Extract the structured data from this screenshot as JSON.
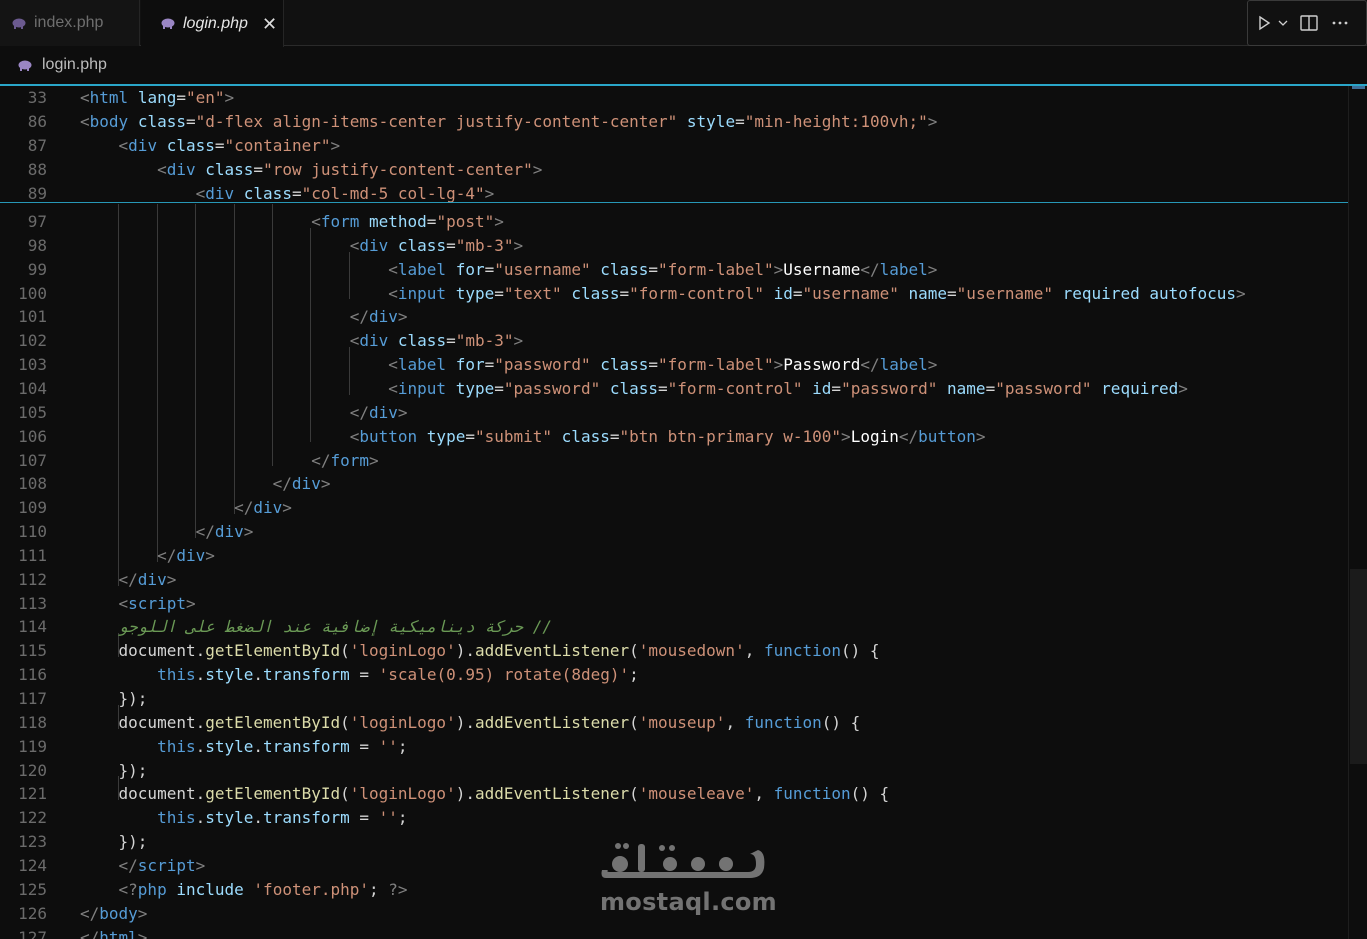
{
  "tabs": [
    {
      "label": "index.php",
      "active": false
    },
    {
      "label": "login.php",
      "active": true
    }
  ],
  "tab_close_glyph": "✕",
  "actions": {
    "run_icon": "play-icon",
    "dropdown_icon": "chevron-down-icon",
    "split_icon": "split-editor-icon",
    "more_icon": "more-icon"
  },
  "breadcrumb": {
    "file": "login.php"
  },
  "colors": {
    "accent": "#2aa6c9",
    "tag": "#569cd6",
    "attribute": "#9cdcfe",
    "string": "#ce9178",
    "function": "#dcdcaa",
    "comment": "#6a9955"
  },
  "sticky_lines": [
    {
      "num": "33",
      "tokens": [
        [
          "p",
          "<"
        ],
        [
          "t",
          "html"
        ],
        [
          "x",
          " "
        ],
        [
          "a",
          "lang"
        ],
        [
          "x",
          "="
        ],
        [
          "s",
          "\"en\""
        ],
        [
          "p",
          ">"
        ]
      ]
    },
    {
      "num": "86",
      "tokens": [
        [
          "p",
          "<"
        ],
        [
          "t",
          "body"
        ],
        [
          "x",
          " "
        ],
        [
          "a",
          "class"
        ],
        [
          "x",
          "="
        ],
        [
          "s",
          "\"d-flex align-items-center justify-content-center\""
        ],
        [
          "x",
          " "
        ],
        [
          "a",
          "style"
        ],
        [
          "x",
          "="
        ],
        [
          "s",
          "\"min-height:100vh;\""
        ],
        [
          "p",
          ">"
        ]
      ]
    },
    {
      "num": "87",
      "tokens": [
        [
          "x",
          "    "
        ],
        [
          "p",
          "<"
        ],
        [
          "t",
          "div"
        ],
        [
          "x",
          " "
        ],
        [
          "a",
          "class"
        ],
        [
          "x",
          "="
        ],
        [
          "s",
          "\"container\""
        ],
        [
          "p",
          ">"
        ]
      ]
    },
    {
      "num": "88",
      "tokens": [
        [
          "x",
          "        "
        ],
        [
          "p",
          "<"
        ],
        [
          "t",
          "div"
        ],
        [
          "x",
          " "
        ],
        [
          "a",
          "class"
        ],
        [
          "x",
          "="
        ],
        [
          "s",
          "\"row justify-content-center\""
        ],
        [
          "p",
          ">"
        ]
      ]
    },
    {
      "num": "89",
      "tokens": [
        [
          "x",
          "            "
        ],
        [
          "p",
          "<"
        ],
        [
          "t",
          "div"
        ],
        [
          "x",
          " "
        ],
        [
          "a",
          "class"
        ],
        [
          "x",
          "="
        ],
        [
          "s",
          "\"col-md-5 col-lg-4\""
        ],
        [
          "p",
          ">"
        ]
      ]
    }
  ],
  "lines": [
    {
      "num": "97",
      "tokens": [
        [
          "x",
          "                        "
        ],
        [
          "p",
          "<"
        ],
        [
          "t",
          "form"
        ],
        [
          "x",
          " "
        ],
        [
          "a",
          "method"
        ],
        [
          "x",
          "="
        ],
        [
          "s",
          "\"post\""
        ],
        [
          "p",
          ">"
        ]
      ]
    },
    {
      "num": "98",
      "tokens": [
        [
          "x",
          "                            "
        ],
        [
          "p",
          "<"
        ],
        [
          "t",
          "div"
        ],
        [
          "x",
          " "
        ],
        [
          "a",
          "class"
        ],
        [
          "x",
          "="
        ],
        [
          "s",
          "\"mb-3\""
        ],
        [
          "p",
          ">"
        ]
      ]
    },
    {
      "num": "99",
      "tokens": [
        [
          "x",
          "                                "
        ],
        [
          "p",
          "<"
        ],
        [
          "t",
          "label"
        ],
        [
          "x",
          " "
        ],
        [
          "a",
          "for"
        ],
        [
          "x",
          "="
        ],
        [
          "s",
          "\"username\""
        ],
        [
          "x",
          " "
        ],
        [
          "a",
          "class"
        ],
        [
          "x",
          "="
        ],
        [
          "s",
          "\"form-label\""
        ],
        [
          "p",
          ">"
        ],
        [
          "tx",
          "Username"
        ],
        [
          "p",
          "</"
        ],
        [
          "t",
          "label"
        ],
        [
          "p",
          ">"
        ]
      ]
    },
    {
      "num": "100",
      "tokens": [
        [
          "x",
          "                                "
        ],
        [
          "p",
          "<"
        ],
        [
          "t",
          "input"
        ],
        [
          "x",
          " "
        ],
        [
          "a",
          "type"
        ],
        [
          "x",
          "="
        ],
        [
          "s",
          "\"text\""
        ],
        [
          "x",
          " "
        ],
        [
          "a",
          "class"
        ],
        [
          "x",
          "="
        ],
        [
          "s",
          "\"form-control\""
        ],
        [
          "x",
          " "
        ],
        [
          "a",
          "id"
        ],
        [
          "x",
          "="
        ],
        [
          "s",
          "\"username\""
        ],
        [
          "x",
          " "
        ],
        [
          "a",
          "name"
        ],
        [
          "x",
          "="
        ],
        [
          "s",
          "\"username\""
        ],
        [
          "x",
          " "
        ],
        [
          "a",
          "required"
        ],
        [
          "x",
          " "
        ],
        [
          "a",
          "autofocus"
        ],
        [
          "p",
          ">"
        ]
      ]
    },
    {
      "num": "101",
      "tokens": [
        [
          "x",
          "                            "
        ],
        [
          "p",
          "</"
        ],
        [
          "t",
          "div"
        ],
        [
          "p",
          ">"
        ]
      ]
    },
    {
      "num": "102",
      "tokens": [
        [
          "x",
          "                            "
        ],
        [
          "p",
          "<"
        ],
        [
          "t",
          "div"
        ],
        [
          "x",
          " "
        ],
        [
          "a",
          "class"
        ],
        [
          "x",
          "="
        ],
        [
          "s",
          "\"mb-3\""
        ],
        [
          "p",
          ">"
        ]
      ]
    },
    {
      "num": "103",
      "tokens": [
        [
          "x",
          "                                "
        ],
        [
          "p",
          "<"
        ],
        [
          "t",
          "label"
        ],
        [
          "x",
          " "
        ],
        [
          "a",
          "for"
        ],
        [
          "x",
          "="
        ],
        [
          "s",
          "\"password\""
        ],
        [
          "x",
          " "
        ],
        [
          "a",
          "class"
        ],
        [
          "x",
          "="
        ],
        [
          "s",
          "\"form-label\""
        ],
        [
          "p",
          ">"
        ],
        [
          "tx",
          "Password"
        ],
        [
          "p",
          "</"
        ],
        [
          "t",
          "label"
        ],
        [
          "p",
          ">"
        ]
      ]
    },
    {
      "num": "104",
      "tokens": [
        [
          "x",
          "                                "
        ],
        [
          "p",
          "<"
        ],
        [
          "t",
          "input"
        ],
        [
          "x",
          " "
        ],
        [
          "a",
          "type"
        ],
        [
          "x",
          "="
        ],
        [
          "s",
          "\"password\""
        ],
        [
          "x",
          " "
        ],
        [
          "a",
          "class"
        ],
        [
          "x",
          "="
        ],
        [
          "s",
          "\"form-control\""
        ],
        [
          "x",
          " "
        ],
        [
          "a",
          "id"
        ],
        [
          "x",
          "="
        ],
        [
          "s",
          "\"password\""
        ],
        [
          "x",
          " "
        ],
        [
          "a",
          "name"
        ],
        [
          "x",
          "="
        ],
        [
          "s",
          "\"password\""
        ],
        [
          "x",
          " "
        ],
        [
          "a",
          "required"
        ],
        [
          "p",
          ">"
        ]
      ]
    },
    {
      "num": "105",
      "tokens": [
        [
          "x",
          "                            "
        ],
        [
          "p",
          "</"
        ],
        [
          "t",
          "div"
        ],
        [
          "p",
          ">"
        ]
      ]
    },
    {
      "num": "106",
      "tokens": [
        [
          "x",
          "                            "
        ],
        [
          "p",
          "<"
        ],
        [
          "t",
          "button"
        ],
        [
          "x",
          " "
        ],
        [
          "a",
          "type"
        ],
        [
          "x",
          "="
        ],
        [
          "s",
          "\"submit\""
        ],
        [
          "x",
          " "
        ],
        [
          "a",
          "class"
        ],
        [
          "x",
          "="
        ],
        [
          "s",
          "\"btn btn-primary w-100\""
        ],
        [
          "p",
          ">"
        ],
        [
          "tx",
          "Login"
        ],
        [
          "p",
          "</"
        ],
        [
          "t",
          "button"
        ],
        [
          "p",
          ">"
        ]
      ]
    },
    {
      "num": "107",
      "tokens": [
        [
          "x",
          "                        "
        ],
        [
          "p",
          "</"
        ],
        [
          "t",
          "form"
        ],
        [
          "p",
          ">"
        ]
      ]
    },
    {
      "num": "108",
      "tokens": [
        [
          "x",
          "                    "
        ],
        [
          "p",
          "</"
        ],
        [
          "t",
          "div"
        ],
        [
          "p",
          ">"
        ]
      ]
    },
    {
      "num": "109",
      "tokens": [
        [
          "x",
          "                "
        ],
        [
          "p",
          "</"
        ],
        [
          "t",
          "div"
        ],
        [
          "p",
          ">"
        ]
      ]
    },
    {
      "num": "110",
      "tokens": [
        [
          "x",
          "            "
        ],
        [
          "p",
          "</"
        ],
        [
          "t",
          "div"
        ],
        [
          "p",
          ">"
        ]
      ]
    },
    {
      "num": "111",
      "tokens": [
        [
          "x",
          "        "
        ],
        [
          "p",
          "</"
        ],
        [
          "t",
          "div"
        ],
        [
          "p",
          ">"
        ]
      ]
    },
    {
      "num": "112",
      "tokens": [
        [
          "x",
          "    "
        ],
        [
          "p",
          "</"
        ],
        [
          "t",
          "div"
        ],
        [
          "p",
          ">"
        ]
      ]
    },
    {
      "num": "113",
      "tokens": [
        [
          "x",
          "    "
        ],
        [
          "p",
          "<"
        ],
        [
          "t",
          "script"
        ],
        [
          "p",
          ">"
        ]
      ]
    },
    {
      "num": "114",
      "tokens": [
        [
          "x",
          "    "
        ],
        [
          "c",
          "// حركة ديناميكية إضافية عند الضغط على اللوجو"
        ]
      ]
    },
    {
      "num": "115",
      "tokens": [
        [
          "x",
          "    "
        ],
        [
          "x",
          "document."
        ],
        [
          "f",
          "getElementById"
        ],
        [
          "x",
          "("
        ],
        [
          "s",
          "'loginLogo'"
        ],
        [
          "x",
          ")."
        ],
        [
          "f",
          "addEventListener"
        ],
        [
          "x",
          "("
        ],
        [
          "s",
          "'mousedown'"
        ],
        [
          "x",
          ", "
        ],
        [
          "k",
          "function"
        ],
        [
          "x",
          "() {"
        ]
      ]
    },
    {
      "num": "116",
      "tokens": [
        [
          "x",
          "        "
        ],
        [
          "k",
          "this"
        ],
        [
          "x",
          "."
        ],
        [
          "pr",
          "style"
        ],
        [
          "x",
          "."
        ],
        [
          "pr",
          "transform"
        ],
        [
          "x",
          " = "
        ],
        [
          "s",
          "'scale(0.95) rotate(8deg)'"
        ],
        [
          "x",
          ";"
        ]
      ]
    },
    {
      "num": "117",
      "tokens": [
        [
          "x",
          "    "
        ],
        [
          "x",
          "});"
        ]
      ]
    },
    {
      "num": "118",
      "tokens": [
        [
          "x",
          "    "
        ],
        [
          "x",
          "document."
        ],
        [
          "f",
          "getElementById"
        ],
        [
          "x",
          "("
        ],
        [
          "s",
          "'loginLogo'"
        ],
        [
          "x",
          ")."
        ],
        [
          "f",
          "addEventListener"
        ],
        [
          "x",
          "("
        ],
        [
          "s",
          "'mouseup'"
        ],
        [
          "x",
          ", "
        ],
        [
          "k",
          "function"
        ],
        [
          "x",
          "() {"
        ]
      ]
    },
    {
      "num": "119",
      "tokens": [
        [
          "x",
          "        "
        ],
        [
          "k",
          "this"
        ],
        [
          "x",
          "."
        ],
        [
          "pr",
          "style"
        ],
        [
          "x",
          "."
        ],
        [
          "pr",
          "transform"
        ],
        [
          "x",
          " = "
        ],
        [
          "s",
          "''"
        ],
        [
          "x",
          ";"
        ]
      ]
    },
    {
      "num": "120",
      "tokens": [
        [
          "x",
          "    "
        ],
        [
          "x",
          "});"
        ]
      ]
    },
    {
      "num": "121",
      "tokens": [
        [
          "x",
          "    "
        ],
        [
          "x",
          "document."
        ],
        [
          "f",
          "getElementById"
        ],
        [
          "x",
          "("
        ],
        [
          "s",
          "'loginLogo'"
        ],
        [
          "x",
          ")."
        ],
        [
          "f",
          "addEventListener"
        ],
        [
          "x",
          "("
        ],
        [
          "s",
          "'mouseleave'"
        ],
        [
          "x",
          ", "
        ],
        [
          "k",
          "function"
        ],
        [
          "x",
          "() {"
        ]
      ]
    },
    {
      "num": "122",
      "tokens": [
        [
          "x",
          "        "
        ],
        [
          "k",
          "this"
        ],
        [
          "x",
          "."
        ],
        [
          "pr",
          "style"
        ],
        [
          "x",
          "."
        ],
        [
          "pr",
          "transform"
        ],
        [
          "x",
          " = "
        ],
        [
          "s",
          "''"
        ],
        [
          "x",
          ";"
        ]
      ]
    },
    {
      "num": "123",
      "tokens": [
        [
          "x",
          "    "
        ],
        [
          "x",
          "});"
        ]
      ]
    },
    {
      "num": "124",
      "tokens": [
        [
          "x",
          "    "
        ],
        [
          "p",
          "</"
        ],
        [
          "t",
          "script"
        ],
        [
          "p",
          ">"
        ]
      ]
    },
    {
      "num": "125",
      "tokens": [
        [
          "x",
          "    "
        ],
        [
          "p",
          "<?"
        ],
        [
          "t",
          "php"
        ],
        [
          "x",
          " "
        ],
        [
          "a",
          "include"
        ],
        [
          "x",
          " "
        ],
        [
          "s",
          "'footer.php'"
        ],
        [
          "x",
          "; "
        ],
        [
          "p",
          "?>"
        ]
      ]
    },
    {
      "num": "126",
      "tokens": [
        [
          "p",
          "</"
        ],
        [
          "t",
          "body"
        ],
        [
          "p",
          ">"
        ]
      ]
    },
    {
      "num": "127",
      "tokens": [
        [
          "p",
          "</"
        ],
        [
          "t",
          "html"
        ],
        [
          "p",
          ">"
        ]
      ]
    }
  ],
  "watermark": {
    "arabic": "مستقل",
    "latin": "mostaql.com"
  }
}
